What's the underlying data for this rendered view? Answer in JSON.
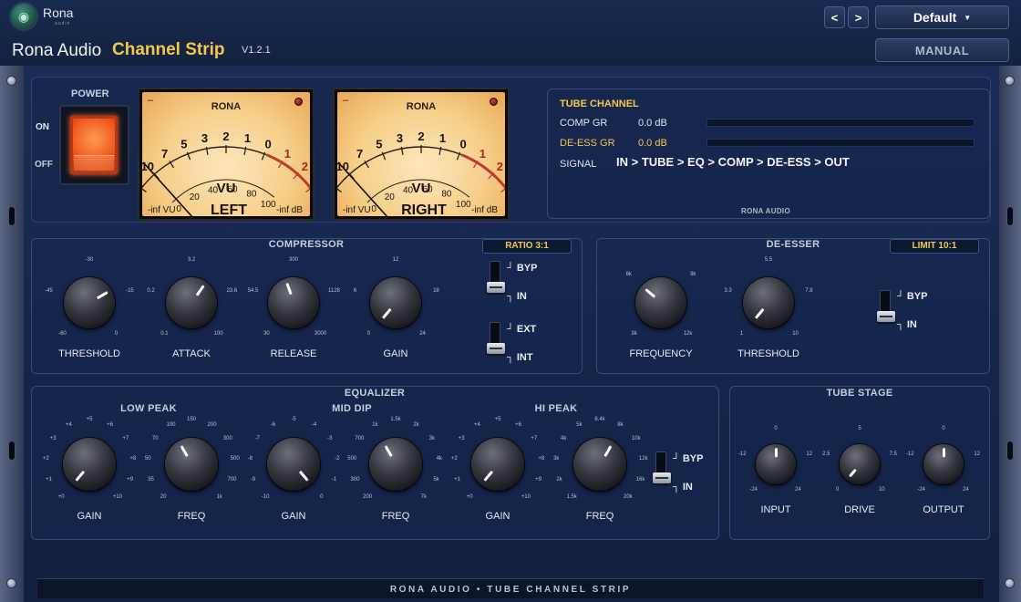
{
  "header": {
    "logo_name": "Rona",
    "logo_sub": "audio",
    "brand": "Rona Audio",
    "product": "Channel Strip",
    "version": "V1.2.1",
    "prev": "<",
    "next": ">",
    "preset": "Default",
    "manual": "MANUAL"
  },
  "power": {
    "label": "POWER",
    "on": "ON",
    "off": "OFF"
  },
  "vu_left": {
    "brand": "RONA",
    "dash": "–",
    "word": "VU",
    "name": "LEFT",
    "left_read": "-inf VU",
    "right_read": "-inf dB"
  },
  "vu_right": {
    "brand": "RONA",
    "dash": "–",
    "word": "VU",
    "name": "RIGHT",
    "left_read": "-inf VU",
    "right_read": "-inf dB"
  },
  "vu_scale": {
    "outer": [
      "20",
      "10",
      "7",
      "5",
      "3",
      "2",
      "1",
      "0",
      "1",
      "2",
      "3"
    ],
    "inner": [
      "0",
      "20",
      "40",
      "60",
      "80",
      "100"
    ]
  },
  "tube_info": {
    "title": "TUBE CHANNEL",
    "comp_gr_label": "COMP GR",
    "comp_gr_value": "0.0 dB",
    "deess_gr_label": "DE-ESS GR",
    "deess_gr_value": "0.0 dB",
    "signal_label": "SIGNAL",
    "signal_flow": "IN > TUBE > EQ > COMP > DE-ESS > OUT",
    "brand": "RONA AUDIO"
  },
  "compressor": {
    "title": "COMPRESSOR",
    "ratio": "RATIO 3:1",
    "knobs": [
      {
        "label": "THRESHOLD",
        "ticks": [
          "-30",
          "-45",
          "-15",
          "-60",
          "0"
        ]
      },
      {
        "label": "ATTACK",
        "ticks": [
          "3.2",
          "0.2",
          "23.6",
          "0.1",
          "100"
        ]
      },
      {
        "label": "RELEASE",
        "ticks": [
          "300",
          "54.5",
          "1128",
          "30",
          "3000"
        ]
      },
      {
        "label": "GAIN",
        "ticks": [
          "12",
          "6",
          "18",
          "0",
          "24"
        ]
      }
    ],
    "toggle1": {
      "top": "BYP",
      "bottom": "IN"
    },
    "toggle2": {
      "top": "EXT",
      "bottom": "INT"
    }
  },
  "deesser": {
    "title": "DE-ESSER",
    "limit": "LIMIT 10:1",
    "knobs": [
      {
        "label": "FREQUENCY",
        "ticks": [
          "6k",
          "9k",
          "3k",
          "12k"
        ]
      },
      {
        "label": "THRESHOLD",
        "ticks": [
          "5.5",
          "3.3",
          "7.8",
          "1",
          "10"
        ]
      }
    ],
    "toggle": {
      "top": "BYP",
      "bottom": "IN"
    }
  },
  "equalizer": {
    "title": "EQUALIZER",
    "bands": [
      "LOW PEAK",
      "MID DIP",
      "HI PEAK"
    ],
    "knobs": [
      {
        "label": "GAIN",
        "ticks": [
          "+5",
          "+4",
          "+6",
          "+3",
          "+7",
          "+2",
          "+8",
          "+1",
          "+9",
          "+0",
          "+10"
        ]
      },
      {
        "label": "FREQ",
        "ticks": [
          "150",
          "100",
          "200",
          "70",
          "300",
          "50",
          "500",
          "35",
          "700",
          "20",
          "1k"
        ]
      },
      {
        "label": "GAIN",
        "ticks": [
          "-5",
          "-6",
          "-4",
          "-7",
          "-3",
          "-8",
          "-2",
          "-9",
          "-1",
          "-10",
          "0"
        ]
      },
      {
        "label": "FREQ",
        "ticks": [
          "1.5k",
          "1k",
          "2k",
          "700",
          "3k",
          "500",
          "4k",
          "300",
          "5k",
          "200",
          "7k"
        ]
      },
      {
        "label": "GAIN",
        "ticks": [
          "+5",
          "+4",
          "+6",
          "+3",
          "+7",
          "+2",
          "+8",
          "+1",
          "+9",
          "+0",
          "+10"
        ]
      },
      {
        "label": "FREQ",
        "ticks": [
          "6.4k",
          "5k",
          "8k",
          "4k",
          "10k",
          "3k",
          "12k",
          "2k",
          "16k",
          "1.5k",
          "20k"
        ]
      }
    ],
    "toggle": {
      "top": "BYP",
      "bottom": "IN"
    }
  },
  "tube_stage": {
    "title": "TUBE STAGE",
    "knobs": [
      {
        "label": "INPUT",
        "ticks": [
          "0",
          "-12",
          "12",
          "-24",
          "24"
        ]
      },
      {
        "label": "DRIVE",
        "ticks": [
          "5",
          "2.5",
          "7.5",
          "0",
          "10"
        ]
      },
      {
        "label": "OUTPUT",
        "ticks": [
          "0",
          "-12",
          "12",
          "-24",
          "24"
        ]
      }
    ]
  },
  "footer": {
    "text": "RONA AUDIO • TUBE CHANNEL STRIP"
  },
  "colors": {
    "accent": "#f2c94c",
    "panel": "#1a2c57",
    "meter_red": "#c0392b"
  }
}
